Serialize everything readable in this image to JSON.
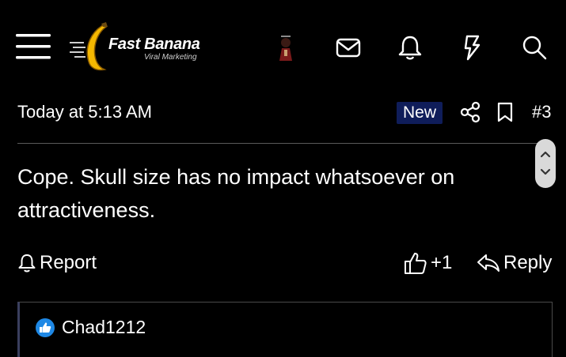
{
  "header": {
    "logo_title": "Fast Banana",
    "logo_subtitle": "Viral Marketing",
    "icons": [
      "menu-icon",
      "avatar",
      "mail-icon",
      "bell-icon",
      "lightning-icon",
      "search-icon"
    ]
  },
  "post": {
    "timestamp": "Today at 5:13 AM",
    "badge": "New",
    "post_number": "#3",
    "body": "Cope. Skull size has no impact whatsoever on attractiveness.",
    "actions": {
      "report": "Report",
      "like_count": "+1",
      "reply": "Reply"
    }
  },
  "reactions": {
    "users": [
      "Chad1212"
    ]
  },
  "colors": {
    "background": "#000000",
    "badge_bg": "#0f1d5a",
    "reaction_blue": "#1e88e5",
    "scroller": "#d9d9d9"
  }
}
